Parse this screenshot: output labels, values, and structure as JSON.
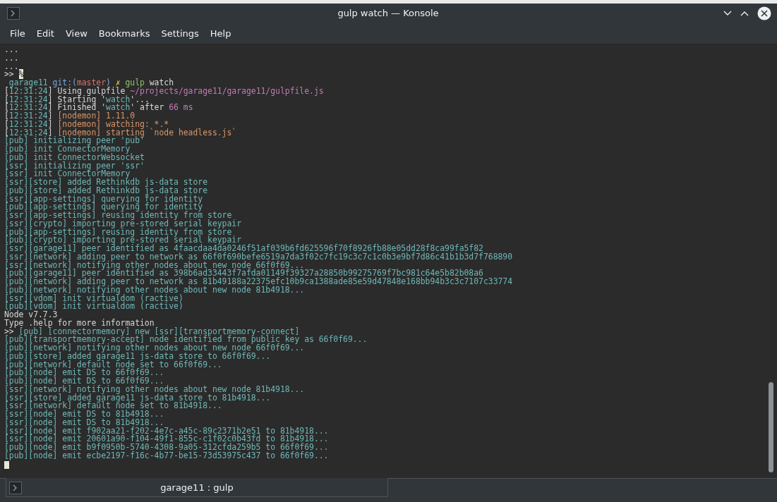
{
  "window": {
    "title": "gulp watch — Konsole"
  },
  "menu": [
    "File",
    "Edit",
    "View",
    "Bookmarks",
    "Settings",
    "Help"
  ],
  "terminal": {
    "lines": [
      {
        "segments": [
          {
            "text": "...",
            "kind": "plain"
          }
        ]
      },
      {
        "segments": [
          {
            "text": "...",
            "kind": "plain"
          }
        ]
      },
      {
        "segments": [
          {
            "text": "...",
            "kind": "plain"
          }
        ]
      },
      {
        "segments": [
          {
            "text": ">> ",
            "kind": "plain"
          },
          {
            "text": "%",
            "kind": "cursor"
          }
        ]
      },
      {
        "segments": [
          {
            "text": " garage11 ",
            "kind": "log"
          },
          {
            "text": "git:(",
            "kind": "git"
          },
          {
            "text": "master",
            "kind": "branch"
          },
          {
            "text": ") ",
            "kind": "git"
          },
          {
            "text": "✗ ",
            "kind": "mark"
          },
          {
            "text": "gulp",
            "kind": "command"
          },
          {
            "text": " watch",
            "kind": "plain"
          }
        ]
      },
      {
        "segments": [
          {
            "text": "[",
            "kind": "plain"
          },
          {
            "text": "12:31:24",
            "kind": "log"
          },
          {
            "text": "] Using gulpfile ",
            "kind": "plain"
          },
          {
            "text": "~/projects/garage11/garage11/gulpfile.js",
            "kind": "number"
          }
        ]
      },
      {
        "segments": [
          {
            "text": "[",
            "kind": "plain"
          },
          {
            "text": "12:31:24",
            "kind": "log"
          },
          {
            "text": "] Starting '",
            "kind": "plain"
          },
          {
            "text": "watch",
            "kind": "log"
          },
          {
            "text": "'...",
            "kind": "plain"
          }
        ]
      },
      {
        "segments": [
          {
            "text": "[",
            "kind": "plain"
          },
          {
            "text": "12:31:24",
            "kind": "log"
          },
          {
            "text": "] Finished '",
            "kind": "plain"
          },
          {
            "text": "watch",
            "kind": "log"
          },
          {
            "text": "' after ",
            "kind": "plain"
          },
          {
            "text": "66 ms",
            "kind": "number"
          }
        ]
      },
      {
        "segments": [
          {
            "text": "[",
            "kind": "plain"
          },
          {
            "text": "12:31:24",
            "kind": "log"
          },
          {
            "text": "] ",
            "kind": "plain"
          },
          {
            "text": "[nodemon] 1.11.0",
            "kind": "nodemon"
          }
        ]
      },
      {
        "segments": [
          {
            "text": "[",
            "kind": "plain"
          },
          {
            "text": "12:31:24",
            "kind": "log"
          },
          {
            "text": "] ",
            "kind": "plain"
          },
          {
            "text": "[nodemon] watching: *.*",
            "kind": "nodemon"
          }
        ]
      },
      {
        "segments": [
          {
            "text": "[",
            "kind": "plain"
          },
          {
            "text": "12:31:24",
            "kind": "log"
          },
          {
            "text": "] ",
            "kind": "plain"
          },
          {
            "text": "[nodemon] starting `node headless.js`",
            "kind": "nodemon"
          }
        ]
      },
      {
        "segments": [
          {
            "text": "[pub] initializing peer 'pub'",
            "kind": "log"
          }
        ]
      },
      {
        "segments": [
          {
            "text": "[pub] init ConnectorMemory",
            "kind": "log"
          }
        ]
      },
      {
        "segments": [
          {
            "text": "[pub] init ConnectorWebsocket",
            "kind": "log"
          }
        ]
      },
      {
        "segments": [
          {
            "text": "[ssr] initializing peer 'ssr'",
            "kind": "log"
          }
        ]
      },
      {
        "segments": [
          {
            "text": "[ssr] init ConnectorMemory",
            "kind": "log"
          }
        ]
      },
      {
        "segments": [
          {
            "text": "[ssr][store] added Rethinkdb js-data store",
            "kind": "log"
          }
        ]
      },
      {
        "segments": [
          {
            "text": "[pub][store] added Rethinkdb js-data store",
            "kind": "log"
          }
        ]
      },
      {
        "segments": [
          {
            "text": "[ssr][app-settings] querying for identity",
            "kind": "log"
          }
        ]
      },
      {
        "segments": [
          {
            "text": "[pub][app-settings] querying for identity",
            "kind": "log"
          }
        ]
      },
      {
        "segments": [
          {
            "text": "[ssr][app-settings] reusing identity from store",
            "kind": "log"
          }
        ]
      },
      {
        "segments": [
          {
            "text": "[ssr][crypto] importing pre-stored serial keypair",
            "kind": "log"
          }
        ]
      },
      {
        "segments": [
          {
            "text": "[pub][app-settings] reusing identity from store",
            "kind": "log"
          }
        ]
      },
      {
        "segments": [
          {
            "text": "[pub][crypto] importing pre-stored serial keypair",
            "kind": "log"
          }
        ]
      },
      {
        "segments": [
          {
            "text": "[ssr][garage11] peer identified as 4faacdaa4da0246f51af039b6fd625596f70f8926fb88e05dd28f8ca99fa5f82",
            "kind": "log"
          }
        ]
      },
      {
        "segments": [
          {
            "text": "[ssr][network] adding peer to network as 66f0f690befe6519a7da3f02c7fc19c3c7c1c0b3e9bf7d86c41b1b3d7f768890",
            "kind": "log"
          }
        ]
      },
      {
        "segments": [
          {
            "text": "[ssr][network] notifying other nodes about new node 66f0f69...",
            "kind": "log"
          }
        ]
      },
      {
        "segments": [
          {
            "text": "[pub][garage11] peer identified as 398b6ad33443f7afda01149f39327a28850b99275769f7bc981c64e5b82b08a6",
            "kind": "log"
          }
        ]
      },
      {
        "segments": [
          {
            "text": "[pub][network] adding peer to network as 81b49188a22375efc10b9ca1388ade85e59d47848e168bb94b3c3c7107c33774",
            "kind": "log"
          }
        ]
      },
      {
        "segments": [
          {
            "text": "[pub][network] notifying other nodes about new node 81b4918...",
            "kind": "log"
          }
        ]
      },
      {
        "segments": [
          {
            "text": "[ssr][vdom] init virtualdom (ractive)",
            "kind": "log"
          }
        ]
      },
      {
        "segments": [
          {
            "text": "[pub][vdom] init virtualdom (ractive)",
            "kind": "log"
          }
        ]
      },
      {
        "segments": [
          {
            "text": "Node v7.7.3",
            "kind": "plain"
          }
        ]
      },
      {
        "segments": [
          {
            "text": "Type .help for more information",
            "kind": "plain"
          }
        ]
      },
      {
        "segments": [
          {
            "text": ">> ",
            "kind": "plain"
          },
          {
            "text": "[pub] [connectormemory] new [ssr][transportmemory-connect]",
            "kind": "log"
          }
        ]
      },
      {
        "segments": [
          {
            "text": "[pub][transportmemory-accept] node identified from public key as 66f0f69...",
            "kind": "log"
          }
        ]
      },
      {
        "segments": [
          {
            "text": "[pub][network] notifying other nodes about new node 66f0f69...",
            "kind": "log"
          }
        ]
      },
      {
        "segments": [
          {
            "text": "[pub][store] added garage11 js-data store to 66f0f69...",
            "kind": "log"
          }
        ]
      },
      {
        "segments": [
          {
            "text": "[pub][network] default node set to 66f0f69...",
            "kind": "log"
          }
        ]
      },
      {
        "segments": [
          {
            "text": "[pub][node] emit DS to 66f0f69...",
            "kind": "log"
          }
        ]
      },
      {
        "segments": [
          {
            "text": "[pub][node] emit DS to 66f0f69...",
            "kind": "log"
          }
        ]
      },
      {
        "segments": [
          {
            "text": "[ssr][network] notifying other nodes about new node 81b4918...",
            "kind": "log"
          }
        ]
      },
      {
        "segments": [
          {
            "text": "[ssr][store] added garage11 js-data store to 81b4918...",
            "kind": "log"
          }
        ]
      },
      {
        "segments": [
          {
            "text": "[ssr][network] default node set to 81b4918...",
            "kind": "log"
          }
        ]
      },
      {
        "segments": [
          {
            "text": "[ssr][node] emit DS to 81b4918...",
            "kind": "log"
          }
        ]
      },
      {
        "segments": [
          {
            "text": "[ssr][node] emit DS to 81b4918...",
            "kind": "log"
          }
        ]
      },
      {
        "segments": [
          {
            "text": "[ssr][node] emit f902aa21-f202-4e7c-a45c-89c2371b2e51 to 81b4918...",
            "kind": "log"
          }
        ]
      },
      {
        "segments": [
          {
            "text": "[ssr][node] emit 20601a90-f104-49f1-855c-c1f02c0b43fd to 81b4918...",
            "kind": "log"
          }
        ]
      },
      {
        "segments": [
          {
            "text": "[pub][node] emit b9f0950b-5740-4308-9a05-312cfda259b5 to 66f0f69...",
            "kind": "log"
          }
        ]
      },
      {
        "segments": [
          {
            "text": "[pub][node] emit ecbe2197-f16c-4b77-be15-73d53975c437 to 66f0f69...",
            "kind": "log"
          }
        ]
      }
    ]
  },
  "tabs": [
    {
      "label": "garage11 : gulp",
      "selected": true
    }
  ]
}
